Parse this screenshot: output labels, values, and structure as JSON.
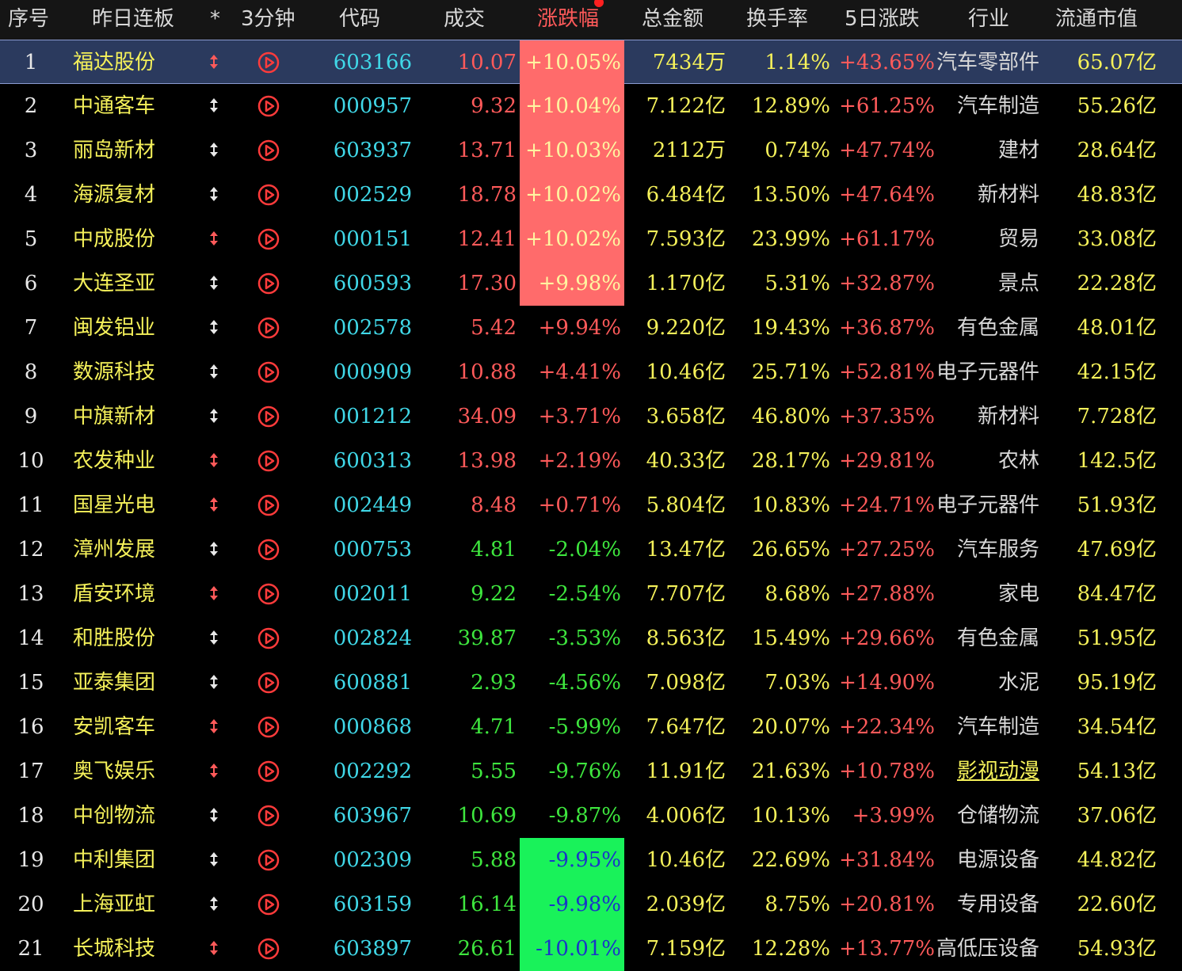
{
  "header": {
    "cols": [
      "序号",
      "昨日连板",
      "*",
      "3分钟",
      "代码",
      "成交",
      "涨跌幅",
      "总金额",
      "换手率",
      "5日涨跌",
      "行业",
      "流通市值"
    ],
    "sort_col_color": "#ff5a5a"
  },
  "rows": [
    {
      "idx": "1",
      "name": "福达股份",
      "star": "red",
      "code": "603166",
      "price": "10.07",
      "chg": "+10.05%",
      "amt": "7434万",
      "turn": "1.14%",
      "d5": "+43.65%",
      "ind": "汽车零部件",
      "mcap": "65.07亿",
      "selected": true
    },
    {
      "idx": "2",
      "name": "中通客车",
      "star": "white",
      "code": "000957",
      "price": "9.32",
      "chg": "+10.04%",
      "amt": "7.122亿",
      "turn": "12.89%",
      "d5": "+61.25%",
      "ind": "汽车制造",
      "mcap": "55.26亿"
    },
    {
      "idx": "3",
      "name": "丽岛新材",
      "star": "white",
      "code": "603937",
      "price": "13.71",
      "chg": "+10.03%",
      "amt": "2112万",
      "turn": "0.74%",
      "d5": "+47.74%",
      "ind": "建材",
      "mcap": "28.64亿"
    },
    {
      "idx": "4",
      "name": "海源复材",
      "star": "white",
      "code": "002529",
      "price": "18.78",
      "chg": "+10.02%",
      "amt": "6.484亿",
      "turn": "13.50%",
      "d5": "+47.64%",
      "ind": "新材料",
      "mcap": "48.83亿"
    },
    {
      "idx": "5",
      "name": "中成股份",
      "star": "red",
      "code": "000151",
      "price": "12.41",
      "chg": "+10.02%",
      "amt": "7.593亿",
      "turn": "23.99%",
      "d5": "+61.17%",
      "ind": "贸易",
      "mcap": "33.08亿"
    },
    {
      "idx": "6",
      "name": "大连圣亚",
      "star": "white",
      "code": "600593",
      "price": "17.30",
      "chg": "+9.98%",
      "amt": "1.170亿",
      "turn": "5.31%",
      "d5": "+32.87%",
      "ind": "景点",
      "mcap": "22.28亿"
    },
    {
      "idx": "7",
      "name": "闽发铝业",
      "star": "white",
      "code": "002578",
      "price": "5.42",
      "chg": "+9.94%",
      "amt": "9.220亿",
      "turn": "19.43%",
      "d5": "+36.87%",
      "ind": "有色金属",
      "mcap": "48.01亿"
    },
    {
      "idx": "8",
      "name": "数源科技",
      "star": "white",
      "code": "000909",
      "price": "10.88",
      "chg": "+4.41%",
      "amt": "10.46亿",
      "turn": "25.71%",
      "d5": "+52.81%",
      "ind": "电子元器件",
      "mcap": "42.15亿"
    },
    {
      "idx": "9",
      "name": "中旗新材",
      "star": "white",
      "code": "001212",
      "price": "34.09",
      "chg": "+3.71%",
      "amt": "3.658亿",
      "turn": "46.80%",
      "d5": "+37.35%",
      "ind": "新材料",
      "mcap": "7.728亿"
    },
    {
      "idx": "10",
      "name": "农发种业",
      "star": "red",
      "code": "600313",
      "price": "13.98",
      "chg": "+2.19%",
      "amt": "40.33亿",
      "turn": "28.17%",
      "d5": "+29.81%",
      "ind": "农林",
      "mcap": "142.5亿"
    },
    {
      "idx": "11",
      "name": "国星光电",
      "star": "red",
      "code": "002449",
      "price": "8.48",
      "chg": "+0.71%",
      "amt": "5.804亿",
      "turn": "10.83%",
      "d5": "+24.71%",
      "ind": "电子元器件",
      "mcap": "51.93亿"
    },
    {
      "idx": "12",
      "name": "漳州发展",
      "star": "white",
      "code": "000753",
      "price": "4.81",
      "chg": "-2.04%",
      "amt": "13.47亿",
      "turn": "26.65%",
      "d5": "+27.25%",
      "ind": "汽车服务",
      "mcap": "47.69亿"
    },
    {
      "idx": "13",
      "name": "盾安环境",
      "star": "red",
      "code": "002011",
      "price": "9.22",
      "chg": "-2.54%",
      "amt": "7.707亿",
      "turn": "8.68%",
      "d5": "+27.88%",
      "ind": "家电",
      "mcap": "84.47亿"
    },
    {
      "idx": "14",
      "name": "和胜股份",
      "star": "white",
      "code": "002824",
      "price": "39.87",
      "chg": "-3.53%",
      "amt": "8.563亿",
      "turn": "15.49%",
      "d5": "+29.66%",
      "ind": "有色金属",
      "mcap": "51.95亿"
    },
    {
      "idx": "15",
      "name": "亚泰集团",
      "star": "white",
      "code": "600881",
      "price": "2.93",
      "chg": "-4.56%",
      "amt": "7.098亿",
      "turn": "7.03%",
      "d5": "+14.90%",
      "ind": "水泥",
      "mcap": "95.19亿"
    },
    {
      "idx": "16",
      "name": "安凯客车",
      "star": "red",
      "code": "000868",
      "price": "4.71",
      "chg": "-5.99%",
      "amt": "7.647亿",
      "turn": "20.07%",
      "d5": "+22.34%",
      "ind": "汽车制造",
      "mcap": "34.54亿"
    },
    {
      "idx": "17",
      "name": "奥飞娱乐",
      "star": "red",
      "code": "002292",
      "price": "5.55",
      "chg": "-9.76%",
      "amt": "11.91亿",
      "turn": "21.63%",
      "d5": "+10.78%",
      "ind": "影视动漫",
      "mcap": "54.13亿",
      "ind_link": true
    },
    {
      "idx": "18",
      "name": "中创物流",
      "star": "white",
      "code": "603967",
      "price": "10.69",
      "chg": "-9.87%",
      "amt": "4.006亿",
      "turn": "10.13%",
      "d5": "+3.99%",
      "ind": "仓储物流",
      "mcap": "37.06亿"
    },
    {
      "idx": "19",
      "name": "中利集团",
      "star": "white",
      "code": "002309",
      "price": "5.88",
      "chg": "-9.95%",
      "amt": "10.46亿",
      "turn": "22.69%",
      "d5": "+31.84%",
      "ind": "电源设备",
      "mcap": "44.82亿"
    },
    {
      "idx": "20",
      "name": "上海亚虹",
      "star": "white",
      "code": "603159",
      "price": "16.14",
      "chg": "-9.98%",
      "amt": "2.039亿",
      "turn": "8.75%",
      "d5": "+20.81%",
      "ind": "专用设备",
      "mcap": "22.60亿"
    },
    {
      "idx": "21",
      "name": "长城科技",
      "star": "red",
      "code": "603897",
      "price": "26.61",
      "chg": "-10.01%",
      "amt": "7.159亿",
      "turn": "12.28%",
      "d5": "+13.77%",
      "ind": "高低压设备",
      "mcap": "54.93亿"
    }
  ],
  "colors": {
    "up": "#ff5a5a",
    "down": "#3ee63e",
    "name": "#f5f15a",
    "code": "#40d8e8",
    "limit_up_bg": "#ff6b6b",
    "limit_down_bg": "#19f25a"
  }
}
